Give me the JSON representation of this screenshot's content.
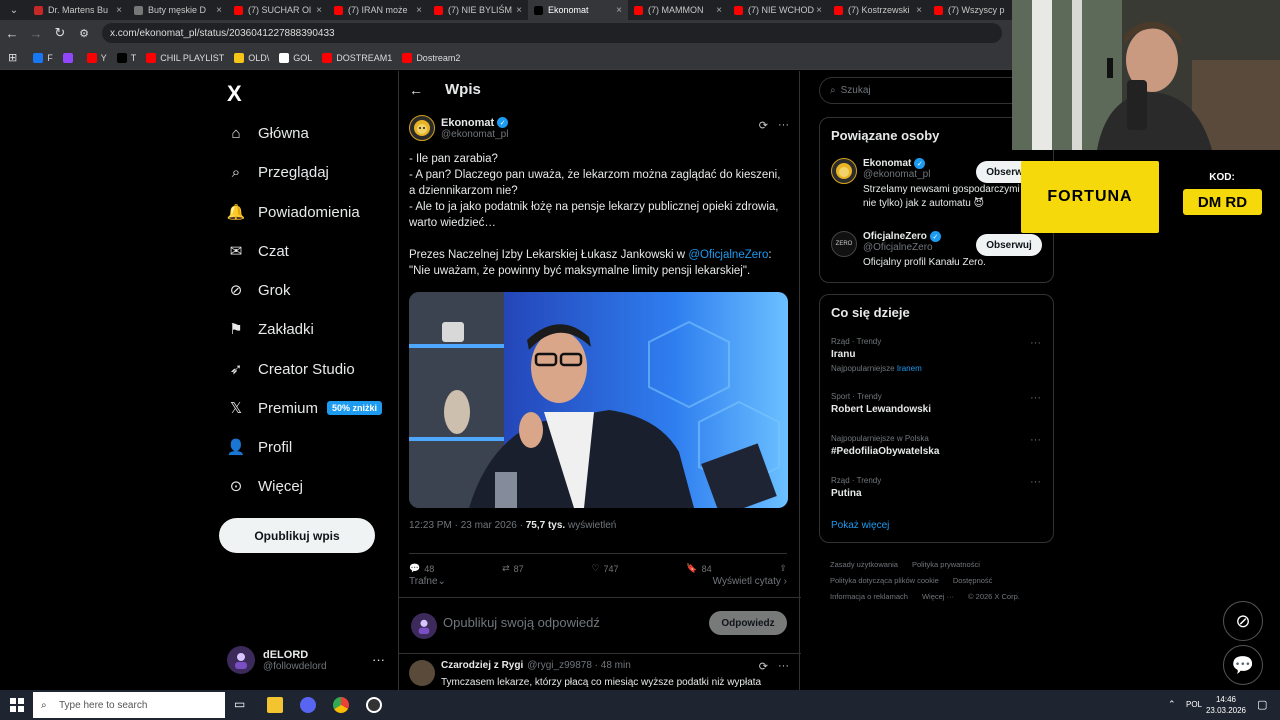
{
  "browser": {
    "tabs": [
      {
        "label": "Dr. Martens Bu",
        "color": "#c62828",
        "active": false
      },
      {
        "label": "Buty męskie D",
        "color": "#777777",
        "active": false
      },
      {
        "label": "(7) SUCHAR Ol",
        "color": "#ff0000",
        "active": false
      },
      {
        "label": "(7) IRAN może",
        "color": "#ff0000",
        "active": false
      },
      {
        "label": "(7) NIE BYLIŚM",
        "color": "#ff0000",
        "active": false
      },
      {
        "label": "Ekonomat",
        "color": "#000000",
        "active": true
      },
      {
        "label": "(7) MAMMON",
        "color": "#ff0000",
        "active": false
      },
      {
        "label": "(7) NIE WCHOD",
        "color": "#ff0000",
        "active": false
      },
      {
        "label": "(7) Kostrzewski",
        "color": "#ff0000",
        "active": false
      },
      {
        "label": "(7) Wszyscy p",
        "color": "#ff0000",
        "active": false
      }
    ],
    "url": "x.com/ekonomat_pl/status/2036041227888390433",
    "bookmarks": [
      {
        "label": "F",
        "color": "#1877f2"
      },
      {
        "label": "",
        "color": "#9146ff"
      },
      {
        "label": "Y",
        "color": "#ff0000"
      },
      {
        "label": "T",
        "color": "#000000"
      },
      {
        "label": "CHIL PLAYLIST",
        "color": "#ff0000"
      },
      {
        "label": "OLD\\",
        "color": "#f5c518"
      },
      {
        "label": "GOL",
        "color": "#ffffff"
      },
      {
        "label": "DOSTREAM1",
        "color": "#ff0000"
      },
      {
        "label": "Dostream2",
        "color": "#ff0000"
      }
    ]
  },
  "nav": {
    "logo": "X",
    "items": [
      {
        "label": "Główna",
        "icon": "home-icon"
      },
      {
        "label": "Przeglądaj",
        "icon": "search-icon"
      },
      {
        "label": "Powiadomienia",
        "icon": "bell-icon"
      },
      {
        "label": "Czat",
        "icon": "mail-icon"
      },
      {
        "label": "Grok",
        "icon": "grok-icon"
      },
      {
        "label": "Zakładki",
        "icon": "bookmark-icon"
      },
      {
        "label": "Creator Studio",
        "icon": "rocket-icon"
      },
      {
        "label": "Premium",
        "icon": "x-logo-icon"
      },
      {
        "label": "Profil",
        "icon": "person-icon"
      },
      {
        "label": "Więcej",
        "icon": "more-circle-icon"
      }
    ],
    "premium_badge": "50% zniżki",
    "post_button": "Opublikuj wpis",
    "account": {
      "name": "dELORD",
      "handle": "@followdelord",
      "more": "···"
    }
  },
  "main": {
    "header": "Wpis",
    "post": {
      "author": "Ekonomat",
      "handle": "@ekonomat_pl",
      "lines": [
        "- Ile pan zarabia?",
        "- A pan? Dlaczego pan uważa, że lekarzom można zaglądać do kieszeni, a dziennikarzom nie?",
        "- Ale to ja jako podatnik łożę na pensje lekarzy publicznej opieki zdrowia, warto wiedzieć…"
      ],
      "quote_intro": "Prezes Naczelnej Izby Lekarskiej Łukasz Jankowski w ",
      "quote_mention": "@OficjalneZero",
      "quote_colon": ":",
      "quote": "\"Nie uważam, że powinny być maksymalne limity pensji lekarskiej\".",
      "time": "12:23 PM · 23 mar 2026 · ",
      "views": "75,7 tys.",
      "views_label": " wyświetleń",
      "stats": {
        "replies": "48",
        "reposts": "87",
        "likes": "747",
        "bookmarks": "84"
      },
      "sort": "Trafne",
      "quotes_link": "Wyświetl cytaty"
    },
    "reply": {
      "placeholder": "Opublikuj swoją odpowiedź",
      "button": "Odpowiedz"
    },
    "next": {
      "author": "Czarodziej z Rygi",
      "handle": "@rygi_z99878",
      "time": "· 48 min",
      "text": "Tymczasem lekarze, którzy płacą co miesiąc wyższe podatki niż wypłata"
    }
  },
  "right": {
    "search_placeholder": "Szukaj",
    "related_title": "Powiązane osoby",
    "people": [
      {
        "name": "Ekonomat",
        "handle": "@ekonomat_pl",
        "bio": "Strzelamy newsami gospodarczymi (ale nie tylko) jak z automatu 😈",
        "button": "Obserwuj"
      },
      {
        "name": "OficjalneZero",
        "handle": "@OficjalneZero",
        "bio": "Oficjalny profil Kanału Zero.",
        "button": "Obserwuj"
      }
    ],
    "trends_title": "Co się dzieje",
    "trends": [
      {
        "context": "Rząd · Trendy",
        "name": "Iranu",
        "sub_prefix": "Najpopularniejsze ",
        "sub_link": "Iranem"
      },
      {
        "context": "Sport · Trendy",
        "name": "Robert Lewandowski",
        "sub_prefix": "",
        "sub_link": ""
      },
      {
        "context": "Najpopularniejsze w Polska",
        "name": "#PedofiliaObywatelska",
        "sub_prefix": "",
        "sub_link": ""
      },
      {
        "context": "Rząd · Trendy",
        "name": "Putina",
        "sub_prefix": "",
        "sub_link": ""
      }
    ],
    "show_more": "Pokaż więcej",
    "footer": [
      "Zasady użytkowania",
      "Polityka prywatności",
      "Polityka dotycząca plików cookie",
      "Dostępność",
      "Informacja o reklamach",
      "Więcej ···",
      "© 2026 X Corp."
    ]
  },
  "overlay": {
    "sponsor": "FORTUNA",
    "kod_label": "KOD:",
    "kod": "DM RD"
  },
  "taskbar": {
    "search": "Type here to search",
    "lang": "POL",
    "time": "14:46",
    "date": "23.03.2026"
  }
}
